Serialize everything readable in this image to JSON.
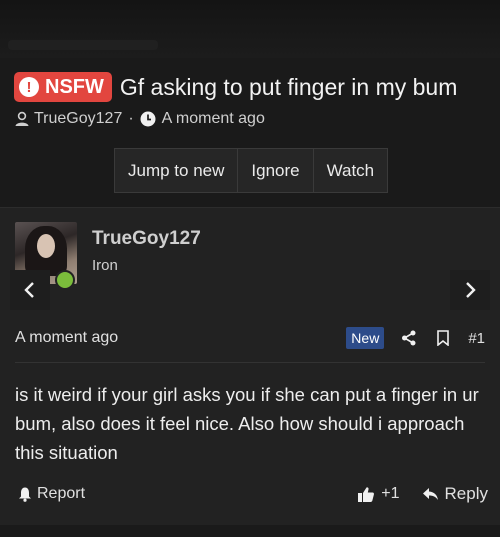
{
  "thread": {
    "badge": "NSFW",
    "badge_color": "#e2463f",
    "title": "Gf asking to put finger in my bum",
    "author": "TrueGoy127",
    "separator": "·",
    "time": "A moment ago"
  },
  "actions": {
    "jump": "Jump to new",
    "ignore": "Ignore",
    "watch": "Watch"
  },
  "post": {
    "username": "TrueGoy127",
    "user_title": "Iron",
    "online_color": "#7bbd3b",
    "date": "A moment ago",
    "new_badge": "New",
    "number": "#1",
    "body": "is it weird if your girl asks you if she can put a finger in ur bum, also does it feel nice. Also how should i approach this situation",
    "report": "Report",
    "likes": "+1",
    "reply": "Reply"
  },
  "icons": {
    "prev": "chevron-left-icon",
    "next": "chevron-right-icon",
    "share": "share-icon",
    "bookmark": "bookmark-icon",
    "report": "bell-icon",
    "like": "thumbs-up-icon",
    "reply": "reply-arrow-icon"
  }
}
